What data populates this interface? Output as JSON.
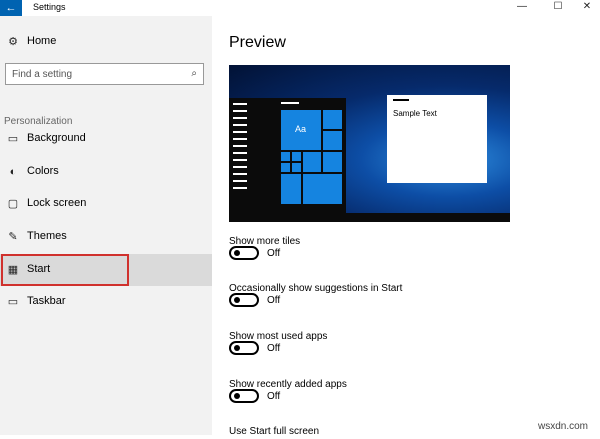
{
  "window": {
    "title": "Settings",
    "back_icon": "←",
    "minimize": "—",
    "maximize": "☐",
    "close": "✕"
  },
  "sidebar": {
    "home": {
      "label": "Home",
      "icon": "gear-icon",
      "glyph": "⚙"
    },
    "search": {
      "placeholder": "Find a setting",
      "icon": "search-icon",
      "glyph": "⌕"
    },
    "section_label": "Personalization",
    "items": [
      {
        "label": "Background",
        "icon": "background-icon",
        "glyph": "▭"
      },
      {
        "label": "Colors",
        "icon": "palette-icon",
        "glyph": "◐"
      },
      {
        "label": "Lock screen",
        "icon": "lock-screen-icon",
        "glyph": "▢"
      },
      {
        "label": "Themes",
        "icon": "themes-icon",
        "glyph": "✎"
      },
      {
        "label": "Start",
        "icon": "start-icon",
        "glyph": "▦",
        "selected": true
      },
      {
        "label": "Taskbar",
        "icon": "taskbar-icon",
        "glyph": "▭"
      }
    ],
    "selection_color": "#d0312d"
  },
  "main": {
    "title": "Preview",
    "preview": {
      "sample_text": "Sample Text",
      "tile_text": "Aa"
    },
    "settings": [
      {
        "label": "Show more tiles",
        "state": "Off"
      },
      {
        "label": "Occasionally show suggestions in Start",
        "state": "Off"
      },
      {
        "label": "Show most used apps",
        "state": "Off"
      },
      {
        "label": "Show recently added apps",
        "state": "Off"
      },
      {
        "label": "Use Start full screen"
      }
    ]
  },
  "colors": {
    "accent": "#0063b1",
    "tile": "#1584e0"
  },
  "watermark": "wsxdn.com"
}
